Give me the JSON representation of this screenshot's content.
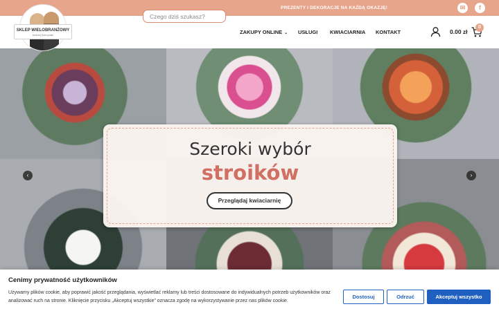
{
  "topbar": {
    "promo": "PREZENTY I DEKORACJE NA KAŻDĄ OKAZJĘ!",
    "social": [
      {
        "icon": "mail-icon",
        "glyph": "✉"
      },
      {
        "icon": "facebook-icon",
        "glyph": "f"
      }
    ]
  },
  "header": {
    "logo": {
      "title": "SKLEP WIELOBRANŻOWY",
      "subtitle": "Andrzej Dobrzyński"
    },
    "search": {
      "placeholder": "Czego dziś szukasz?"
    },
    "nav": [
      {
        "label": "ZAKUPY ONLINE",
        "has_dropdown": true
      },
      {
        "label": "USŁUGI"
      },
      {
        "label": "KWIACIARNIA"
      },
      {
        "label": "KONTAKT"
      }
    ],
    "cart": {
      "total": "0.00 zł",
      "count": "0"
    }
  },
  "hero": {
    "heading": "Szeroki wybór",
    "highlight": "stroików",
    "cta": "Przeglądaj kwiaciarnię",
    "prev_glyph": "‹",
    "next_glyph": "›"
  },
  "cookie": {
    "title": "Cenimy prywatność użytkowników",
    "text": "Używamy plików cookie, aby poprawić jakość przeglądania, wyświetlać reklamy lub treści dostosowane do indywidualnych potrzeb użytkowników oraz analizować ruch na stronie. Kliknięcie przycisku „Akceptuj wszystkie” oznacza zgodę na wykorzystywanie przez nas plików cookie.",
    "buttons": {
      "customize": "Dostosuj",
      "reject": "Odrzuć",
      "accept": "Akceptuj wszystko"
    }
  },
  "colors": {
    "accent": "#e7a58c",
    "highlight": "#d06f62",
    "button_blue": "#1f5fbf"
  }
}
